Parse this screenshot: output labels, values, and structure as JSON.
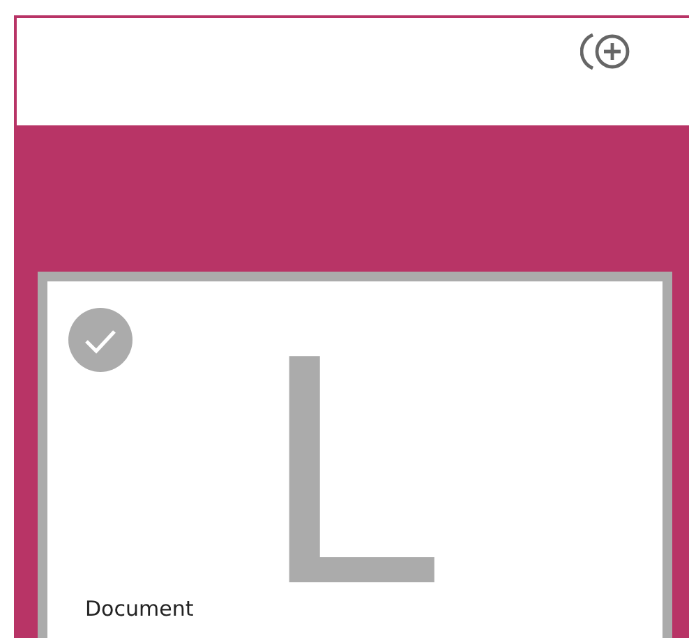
{
  "card": {
    "letter": "L",
    "name": "Document",
    "selected": true
  }
}
